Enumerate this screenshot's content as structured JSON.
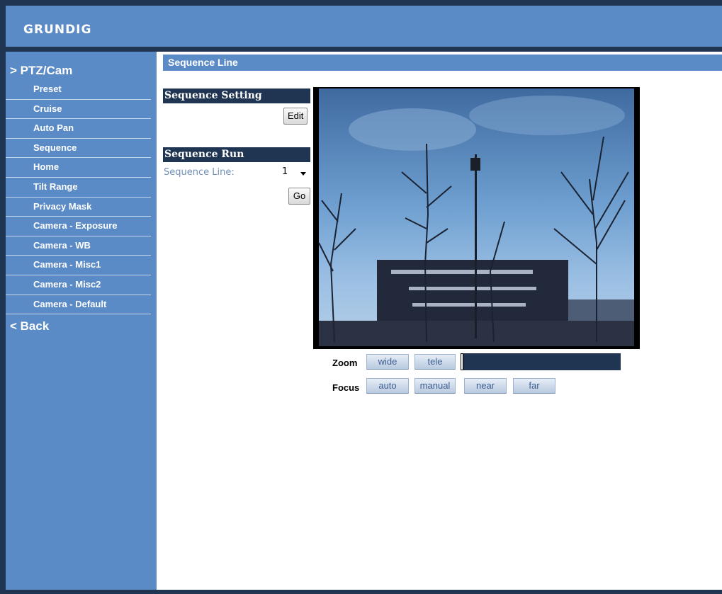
{
  "brand": "GRUNDIG",
  "sidebar": {
    "section": "> PTZ/Cam",
    "items": [
      "Preset",
      "Cruise",
      "Auto Pan",
      "Sequence",
      "Home",
      "Tilt Range",
      "Privacy Mask",
      "Camera - Exposure",
      "Camera - WB",
      "Camera - Misc1",
      "Camera - Misc2",
      "Camera - Default"
    ],
    "back": "< Back"
  },
  "page": {
    "title": "Sequence Line"
  },
  "sequence_setting": {
    "header": "Sequence Setting",
    "edit_label": "Edit"
  },
  "sequence_run": {
    "header": "Sequence Run",
    "line_label": "Sequence Line:",
    "line_value": "1",
    "go_label": "Go"
  },
  "controls": {
    "zoom_label": "Zoom",
    "wide": "wide",
    "tele": "tele",
    "focus_label": "Focus",
    "auto": "auto",
    "manual": "manual",
    "near": "near",
    "far": "far",
    "zoom_level": 0
  },
  "colors": {
    "accent": "#5b8bc7",
    "dark": "#1f3552"
  }
}
